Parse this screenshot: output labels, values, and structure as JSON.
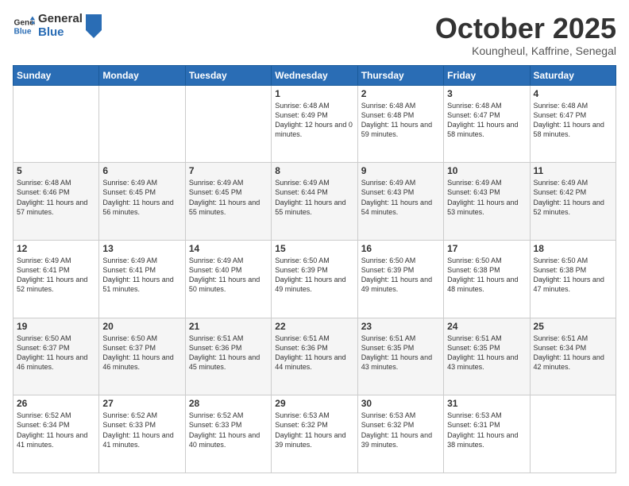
{
  "header": {
    "logo_line1": "General",
    "logo_line2": "Blue",
    "month": "October 2025",
    "location": "Koungheul, Kaffrine, Senegal"
  },
  "days_of_week": [
    "Sunday",
    "Monday",
    "Tuesday",
    "Wednesday",
    "Thursday",
    "Friday",
    "Saturday"
  ],
  "weeks": [
    [
      {
        "day": "",
        "sunrise": "",
        "sunset": "",
        "daylight": ""
      },
      {
        "day": "",
        "sunrise": "",
        "sunset": "",
        "daylight": ""
      },
      {
        "day": "",
        "sunrise": "",
        "sunset": "",
        "daylight": ""
      },
      {
        "day": "1",
        "sunrise": "Sunrise: 6:48 AM",
        "sunset": "Sunset: 6:49 PM",
        "daylight": "Daylight: 12 hours and 0 minutes."
      },
      {
        "day": "2",
        "sunrise": "Sunrise: 6:48 AM",
        "sunset": "Sunset: 6:48 PM",
        "daylight": "Daylight: 11 hours and 59 minutes."
      },
      {
        "day": "3",
        "sunrise": "Sunrise: 6:48 AM",
        "sunset": "Sunset: 6:47 PM",
        "daylight": "Daylight: 11 hours and 58 minutes."
      },
      {
        "day": "4",
        "sunrise": "Sunrise: 6:48 AM",
        "sunset": "Sunset: 6:47 PM",
        "daylight": "Daylight: 11 hours and 58 minutes."
      }
    ],
    [
      {
        "day": "5",
        "sunrise": "Sunrise: 6:48 AM",
        "sunset": "Sunset: 6:46 PM",
        "daylight": "Daylight: 11 hours and 57 minutes."
      },
      {
        "day": "6",
        "sunrise": "Sunrise: 6:49 AM",
        "sunset": "Sunset: 6:45 PM",
        "daylight": "Daylight: 11 hours and 56 minutes."
      },
      {
        "day": "7",
        "sunrise": "Sunrise: 6:49 AM",
        "sunset": "Sunset: 6:45 PM",
        "daylight": "Daylight: 11 hours and 55 minutes."
      },
      {
        "day": "8",
        "sunrise": "Sunrise: 6:49 AM",
        "sunset": "Sunset: 6:44 PM",
        "daylight": "Daylight: 11 hours and 55 minutes."
      },
      {
        "day": "9",
        "sunrise": "Sunrise: 6:49 AM",
        "sunset": "Sunset: 6:43 PM",
        "daylight": "Daylight: 11 hours and 54 minutes."
      },
      {
        "day": "10",
        "sunrise": "Sunrise: 6:49 AM",
        "sunset": "Sunset: 6:43 PM",
        "daylight": "Daylight: 11 hours and 53 minutes."
      },
      {
        "day": "11",
        "sunrise": "Sunrise: 6:49 AM",
        "sunset": "Sunset: 6:42 PM",
        "daylight": "Daylight: 11 hours and 52 minutes."
      }
    ],
    [
      {
        "day": "12",
        "sunrise": "Sunrise: 6:49 AM",
        "sunset": "Sunset: 6:41 PM",
        "daylight": "Daylight: 11 hours and 52 minutes."
      },
      {
        "day": "13",
        "sunrise": "Sunrise: 6:49 AM",
        "sunset": "Sunset: 6:41 PM",
        "daylight": "Daylight: 11 hours and 51 minutes."
      },
      {
        "day": "14",
        "sunrise": "Sunrise: 6:49 AM",
        "sunset": "Sunset: 6:40 PM",
        "daylight": "Daylight: 11 hours and 50 minutes."
      },
      {
        "day": "15",
        "sunrise": "Sunrise: 6:50 AM",
        "sunset": "Sunset: 6:39 PM",
        "daylight": "Daylight: 11 hours and 49 minutes."
      },
      {
        "day": "16",
        "sunrise": "Sunrise: 6:50 AM",
        "sunset": "Sunset: 6:39 PM",
        "daylight": "Daylight: 11 hours and 49 minutes."
      },
      {
        "day": "17",
        "sunrise": "Sunrise: 6:50 AM",
        "sunset": "Sunset: 6:38 PM",
        "daylight": "Daylight: 11 hours and 48 minutes."
      },
      {
        "day": "18",
        "sunrise": "Sunrise: 6:50 AM",
        "sunset": "Sunset: 6:38 PM",
        "daylight": "Daylight: 11 hours and 47 minutes."
      }
    ],
    [
      {
        "day": "19",
        "sunrise": "Sunrise: 6:50 AM",
        "sunset": "Sunset: 6:37 PM",
        "daylight": "Daylight: 11 hours and 46 minutes."
      },
      {
        "day": "20",
        "sunrise": "Sunrise: 6:50 AM",
        "sunset": "Sunset: 6:37 PM",
        "daylight": "Daylight: 11 hours and 46 minutes."
      },
      {
        "day": "21",
        "sunrise": "Sunrise: 6:51 AM",
        "sunset": "Sunset: 6:36 PM",
        "daylight": "Daylight: 11 hours and 45 minutes."
      },
      {
        "day": "22",
        "sunrise": "Sunrise: 6:51 AM",
        "sunset": "Sunset: 6:36 PM",
        "daylight": "Daylight: 11 hours and 44 minutes."
      },
      {
        "day": "23",
        "sunrise": "Sunrise: 6:51 AM",
        "sunset": "Sunset: 6:35 PM",
        "daylight": "Daylight: 11 hours and 43 minutes."
      },
      {
        "day": "24",
        "sunrise": "Sunrise: 6:51 AM",
        "sunset": "Sunset: 6:35 PM",
        "daylight": "Daylight: 11 hours and 43 minutes."
      },
      {
        "day": "25",
        "sunrise": "Sunrise: 6:51 AM",
        "sunset": "Sunset: 6:34 PM",
        "daylight": "Daylight: 11 hours and 42 minutes."
      }
    ],
    [
      {
        "day": "26",
        "sunrise": "Sunrise: 6:52 AM",
        "sunset": "Sunset: 6:34 PM",
        "daylight": "Daylight: 11 hours and 41 minutes."
      },
      {
        "day": "27",
        "sunrise": "Sunrise: 6:52 AM",
        "sunset": "Sunset: 6:33 PM",
        "daylight": "Daylight: 11 hours and 41 minutes."
      },
      {
        "day": "28",
        "sunrise": "Sunrise: 6:52 AM",
        "sunset": "Sunset: 6:33 PM",
        "daylight": "Daylight: 11 hours and 40 minutes."
      },
      {
        "day": "29",
        "sunrise": "Sunrise: 6:53 AM",
        "sunset": "Sunset: 6:32 PM",
        "daylight": "Daylight: 11 hours and 39 minutes."
      },
      {
        "day": "30",
        "sunrise": "Sunrise: 6:53 AM",
        "sunset": "Sunset: 6:32 PM",
        "daylight": "Daylight: 11 hours and 39 minutes."
      },
      {
        "day": "31",
        "sunrise": "Sunrise: 6:53 AM",
        "sunset": "Sunset: 6:31 PM",
        "daylight": "Daylight: 11 hours and 38 minutes."
      },
      {
        "day": "",
        "sunrise": "",
        "sunset": "",
        "daylight": ""
      }
    ]
  ]
}
